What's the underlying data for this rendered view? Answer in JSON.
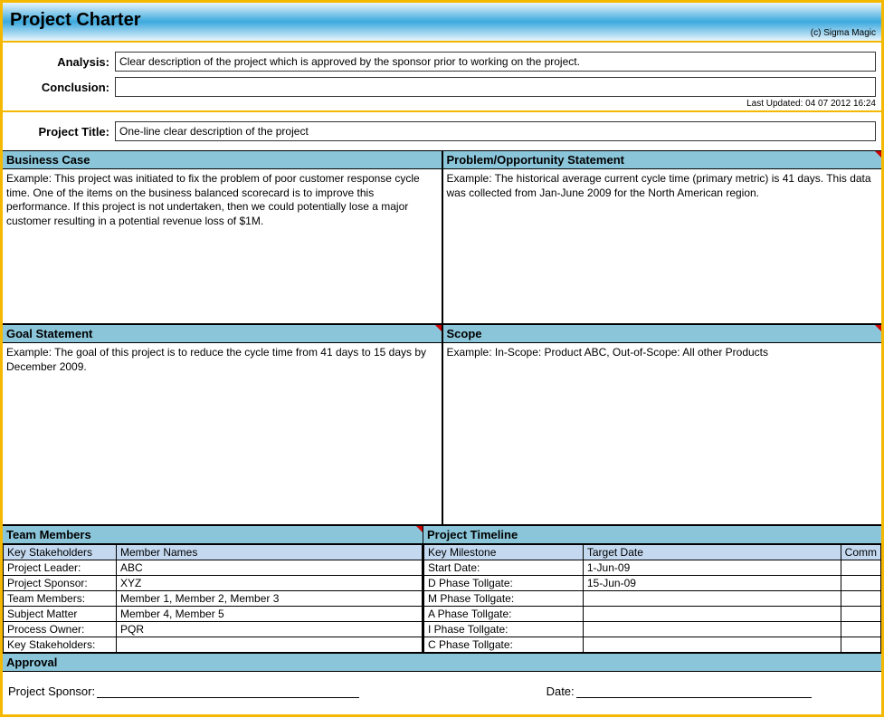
{
  "header": {
    "title": "Project Charter",
    "copyright": "(c) Sigma Magic"
  },
  "top": {
    "analysis_label": "Analysis:",
    "analysis_value": "Clear description of the project which is approved by the sponsor prior to working on the project.",
    "conclusion_label": "Conclusion:",
    "conclusion_value": "",
    "last_updated": "Last Updated: 04 07 2012 16:24"
  },
  "project_title": {
    "label": "Project Title:",
    "value": "One-line clear description of the project"
  },
  "sections": {
    "business_case": {
      "header": "Business Case",
      "body": "Example: This project was initiated to fix the problem of poor customer response cycle time. One of the items on the business balanced scorecard is to improve this performance. If this project is not undertaken, then we could potentially lose a major customer resulting in a potential revenue loss of $1M."
    },
    "problem": {
      "header": "Problem/Opportunity Statement",
      "body": "Example: The historical average current cycle time (primary metric) is 41 days. This data was collected from Jan-June 2009 for the North American region."
    },
    "goal": {
      "header": "Goal Statement",
      "body": "Example: The goal of this project is to reduce the cycle time from 41 days to 15 days by December 2009."
    },
    "scope": {
      "header": "Scope",
      "body": "Example: In-Scope: Product ABC, Out-of-Scope: All other Products"
    },
    "team_members": {
      "header": "Team Members",
      "col1": "Key Stakeholders",
      "col2": "Member Names",
      "rows": [
        {
          "role": "Project Leader:",
          "name": "ABC"
        },
        {
          "role": "Project Sponsor:",
          "name": "XYZ"
        },
        {
          "role": "Team Members:",
          "name": "Member 1, Member 2, Member 3"
        },
        {
          "role": "Subject Matter",
          "name": "Member 4, Member 5"
        },
        {
          "role": "Process Owner:",
          "name": "PQR"
        },
        {
          "role": "Key Stakeholders:",
          "name": ""
        }
      ]
    },
    "timeline": {
      "header": "Project Timeline",
      "col1": "Key Milestone",
      "col2": "Target Date",
      "col3": "Comm",
      "rows": [
        {
          "milestone": "Start Date:",
          "date": "1-Jun-09",
          "comm": ""
        },
        {
          "milestone": "D Phase Tollgate:",
          "date": "15-Jun-09",
          "comm": ""
        },
        {
          "milestone": "M Phase Tollgate:",
          "date": "",
          "comm": ""
        },
        {
          "milestone": "A Phase Tollgate:",
          "date": "",
          "comm": ""
        },
        {
          "milestone": "I Phase Tollgate:",
          "date": "",
          "comm": ""
        },
        {
          "milestone": "C Phase Tollgate:",
          "date": "",
          "comm": ""
        }
      ]
    }
  },
  "approval": {
    "header": "Approval",
    "sponsor_label": "Project Sponsor:",
    "date_label": "Date:"
  }
}
